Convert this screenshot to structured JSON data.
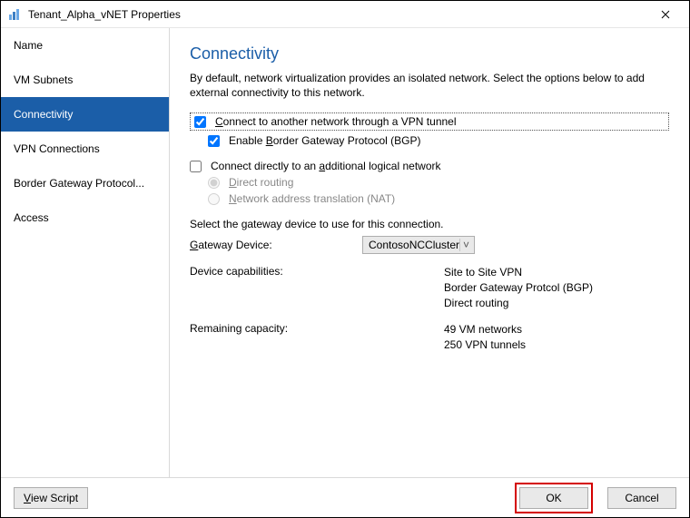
{
  "window": {
    "title": "Tenant_Alpha_vNET Properties"
  },
  "sidebar": {
    "items": [
      {
        "label": "Name"
      },
      {
        "label": "VM Subnets"
      },
      {
        "label": "Connectivity"
      },
      {
        "label": "VPN Connections"
      },
      {
        "label": "Border Gateway Protocol..."
      },
      {
        "label": "Access"
      }
    ]
  },
  "content": {
    "heading": "Connectivity",
    "description": "By default, network virtualization provides an isolated network. Select the options below to add external connectivity to this network.",
    "opts": {
      "vpn_pre": "",
      "vpn_u": "C",
      "vpn_post": "onnect to another network through a VPN tunnel",
      "bgp_pre": "Enable ",
      "bgp_u": "B",
      "bgp_post": "order Gateway Protocol (BGP)",
      "direct_pre": "Connect directly to an ",
      "direct_u": "a",
      "direct_post": "dditional logical network",
      "routing_pre": "",
      "routing_u": "D",
      "routing_post": "irect routing",
      "nat_pre": "",
      "nat_u": "N",
      "nat_post": "etwork address translation (NAT)"
    },
    "gateway": {
      "prompt": "Select the gateway device to use for this connection.",
      "label_pre": "",
      "label_u": "G",
      "label_post": "ateway Device:",
      "selected": "ContosoNCCluster"
    },
    "caps": {
      "label": "Device capabilities:",
      "v1": "Site to Site VPN",
      "v2": "Border Gateway Protcol (BGP)",
      "v3": "Direct routing"
    },
    "remaining": {
      "label": "Remaining capacity:",
      "v1": "49 VM networks",
      "v2": "250 VPN tunnels"
    }
  },
  "footer": {
    "view_script_pre": "",
    "view_script_u": "V",
    "view_script_post": "iew Script",
    "ok": "OK",
    "cancel": "Cancel"
  }
}
